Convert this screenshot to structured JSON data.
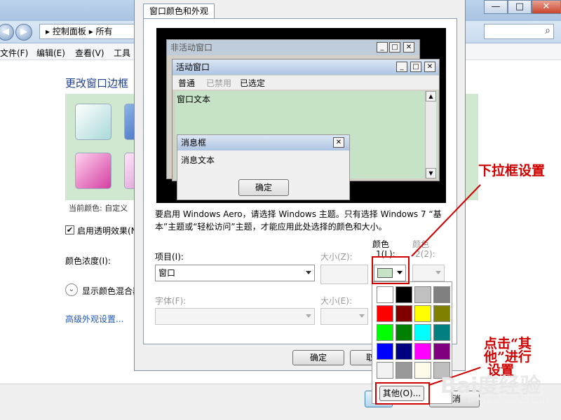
{
  "background": {
    "window_buttons": [
      "—",
      "□",
      "✕"
    ],
    "nav": {
      "back": "◀",
      "forward": "▶"
    },
    "breadcrumb": [
      "控制面板",
      "所有"
    ],
    "search_icon": "⌕",
    "menu": [
      "文件(F)",
      "编辑(E)",
      "查看(V)",
      "工具"
    ],
    "heading": "更改窗口边框",
    "current_color": "当前颜色: 自定义",
    "transparency_checkbox": "启用透明效果(N",
    "color_intensity": "颜色浓度(I):",
    "show_mixer": "显示颜色混合器",
    "advanced_link": "高级外观设置..."
  },
  "dialog": {
    "tab": "窗口颜色和外观",
    "preview": {
      "inactive_title": "非活动窗口",
      "active_title": "活动窗口",
      "menu_normal": "普通",
      "menu_disabled": "已禁用",
      "menu_selected": "已选定",
      "window_text": "窗口文本",
      "msgbox_title": "消息框",
      "msgbox_text": "消息文本",
      "ok": "确定",
      "title_buttons": [
        "_",
        "□",
        "✕"
      ],
      "scroll_up": "▲",
      "scroll_down": "▼"
    },
    "info_line1": "要启用 Windows Aero，请选择 Windows 主题。只有选择 Windows 7 “基",
    "info_line2": "本”主题或“轻松访问”主题，才能应用此处选择的颜色和大小。",
    "item_label": "项目(I):",
    "item_value": "窗口",
    "size1_label": "大小(Z):",
    "color1_label_a": "颜色",
    "color1_label_b": "1(L):",
    "color2_label_a": "颜色",
    "color2_label_b": "2(2):",
    "font_label": "字体(F):",
    "size2_label": "大小(E):",
    "ok_button": "确定",
    "cancel_partial": "取",
    "cancel_partial2": "消",
    "selected_color": "#c7e3c7"
  },
  "palette": {
    "colors": [
      "#ffffff",
      "#000000",
      "#c0c0c0",
      "#808080",
      "#ff0000",
      "#800000",
      "#ffff00",
      "#808000",
      "#00ff00",
      "#008000",
      "#00ffff",
      "#008080",
      "#0000ff",
      "#000080",
      "#ff00ff",
      "#800080",
      "#f2f2f2",
      "#999999",
      "#fffbea",
      "#bfbfbf"
    ],
    "other_button": "其他(O)..."
  },
  "annotations": {
    "dropdown_note": "下拉框设置",
    "click_line1": "点击“其",
    "click_line2": "他”进行",
    "click_line3": "设置",
    "accent_color": "#d00000"
  },
  "watermark": {
    "text": "Bai度经验",
    "url": "jingyan.baidu.com"
  }
}
